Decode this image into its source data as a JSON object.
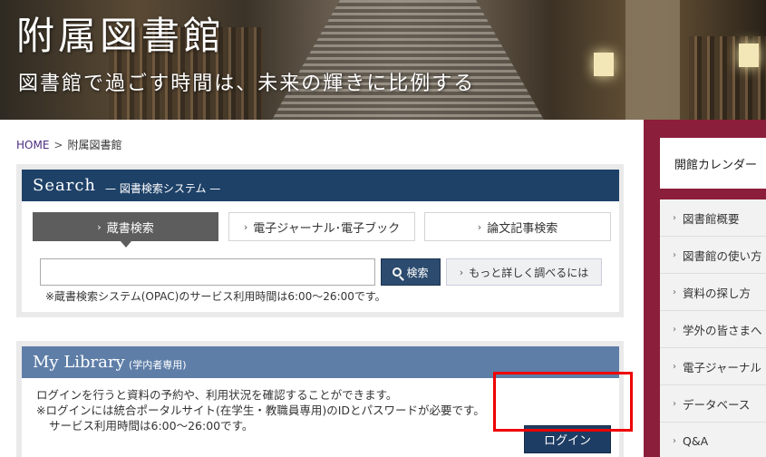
{
  "header": {
    "title": "附属図書館",
    "subtitle": "図書館で過ごす時間は、未来の輝きに比例する"
  },
  "breadcrumb": {
    "home": "HOME",
    "separator": ">",
    "current": "附属図書館"
  },
  "search": {
    "title_en": "Search",
    "title_jp": "— 図書検索システム —",
    "tabs": [
      {
        "label": "蔵書検索",
        "active": true
      },
      {
        "label": "電子ジャーナル･電子ブック",
        "active": false
      },
      {
        "label": "論文記事検索",
        "active": false
      }
    ],
    "input_value": "",
    "button_label": "検索",
    "detail_label": "もっと詳しく調べるには",
    "note": "※蔵書検索システム(OPAC)のサービス利用時間は6:00～26:00です。"
  },
  "mylibrary": {
    "title_en": "My Library",
    "title_sub": "(学内者専用)",
    "line1": "ログインを行うと資料の予約や、利用状況を確認することができます。",
    "line2": "※ログインには統合ポータルサイト(在学生・教職員専用)のIDとパスワードが必要です。",
    "line3": "サービス利用時間は6:00～26:00です。",
    "login_label": "ログイン"
  },
  "sidebar": {
    "calendar_label": "開館カレンダー",
    "items": [
      {
        "label": "図書館概要"
      },
      {
        "label": "図書館の使い方"
      },
      {
        "label": "資料の探し方"
      },
      {
        "label": "学外の皆さまへ"
      },
      {
        "label": "電子ジャーナル"
      },
      {
        "label": "データベース"
      },
      {
        "label": "Q&A"
      }
    ]
  },
  "colors": {
    "search_header": "#1e4168",
    "mylib_header": "#5e7ea8",
    "sidebar_bg": "#8b1e3a",
    "highlight": "#ee0000"
  }
}
